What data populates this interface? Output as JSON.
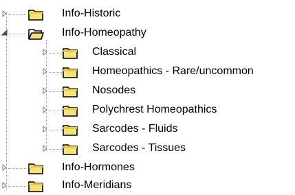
{
  "tree": {
    "nodes": [
      {
        "label": "Info-Historic",
        "expanded": false,
        "icon": "folder-closed-icon",
        "expander": "triangle-right-icon"
      },
      {
        "label": "Info-Homeopathy",
        "expanded": true,
        "icon": "folder-open-icon",
        "expander": "triangle-down-icon",
        "children": [
          {
            "label": "Classical",
            "icon": "folder-closed-icon",
            "expander": "triangle-right-icon"
          },
          {
            "label": "Homeopathics - Rare/uncommon",
            "icon": "folder-closed-icon",
            "expander": "triangle-right-icon"
          },
          {
            "label": "Nosodes",
            "icon": "folder-closed-icon",
            "expander": "triangle-right-icon"
          },
          {
            "label": "Polychrest Homeopathics",
            "icon": "folder-closed-icon",
            "expander": "triangle-right-icon"
          },
          {
            "label": "Sarcodes - Fluids",
            "icon": "folder-closed-icon",
            "expander": "triangle-right-icon"
          },
          {
            "label": "Sarcodes - Tissues",
            "icon": "folder-closed-icon",
            "expander": "triangle-right-icon"
          }
        ]
      },
      {
        "label": "Info-Hormones",
        "expanded": false,
        "icon": "folder-closed-icon",
        "expander": "triangle-right-icon"
      },
      {
        "label": "Info-Meridians",
        "expanded": false,
        "icon": "folder-closed-icon",
        "expander": "triangle-right-icon"
      }
    ],
    "colors": {
      "folder_fill": "#f4e27a",
      "folder_dark": "#000000",
      "folder_tab": "#e8c94a",
      "dotted_line": "#a0a0a0",
      "expander": "#7a7a7a"
    }
  }
}
